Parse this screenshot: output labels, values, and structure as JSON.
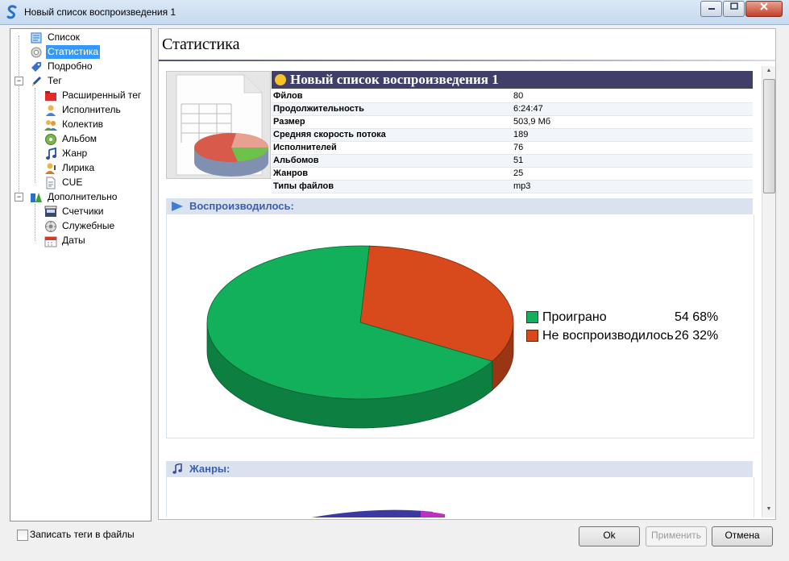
{
  "window": {
    "title": "Новый список воспроизведения 1",
    "controls": [
      "minimize",
      "maximize",
      "close"
    ]
  },
  "sidebar": {
    "items": [
      {
        "label": "Список",
        "icon": "playlist-icon"
      },
      {
        "label": "Статистика",
        "icon": "gear-icon",
        "selected": true
      },
      {
        "label": "Подробно",
        "icon": "tag-detail-icon"
      },
      {
        "label": "Тег",
        "icon": "pen-icon",
        "expanded": true
      },
      {
        "label": "Расширенный тег",
        "icon": "folder-icon"
      },
      {
        "label": "Исполнитель",
        "icon": "person-icon"
      },
      {
        "label": "Колектив",
        "icon": "group-icon"
      },
      {
        "label": "Альбом",
        "icon": "disc-icon"
      },
      {
        "label": "Жанр",
        "icon": "music-note-icon"
      },
      {
        "label": "Лирика",
        "icon": "singer-icon"
      },
      {
        "label": "CUE",
        "icon": "cue-file-icon"
      },
      {
        "label": "Дополнительно",
        "icon": "extra-icon",
        "expanded": true
      },
      {
        "label": "Счетчики",
        "icon": "counter-icon"
      },
      {
        "label": "Служебные",
        "icon": "settings-icon"
      },
      {
        "label": "Даты",
        "icon": "calendar-icon"
      }
    ]
  },
  "page": {
    "title": "Статистика"
  },
  "info": {
    "title": "Новый список воспроизведения 1",
    "rows": [
      {
        "key": "Фйлов",
        "value": "80"
      },
      {
        "key": "Продолжительность",
        "value": "6:24:47"
      },
      {
        "key": "Размер",
        "value": "503,9 Мб"
      },
      {
        "key": "Средняя скорость потока",
        "value": "189"
      },
      {
        "key": "Исполнителей",
        "value": "76"
      },
      {
        "key": "Альбомов",
        "value": "51"
      },
      {
        "key": "Жанров",
        "value": "25"
      },
      {
        "key": "Типы файлов",
        "value": "mp3"
      }
    ]
  },
  "sections": {
    "played": "Воспроизводилось:",
    "genres": "Жанры:"
  },
  "chart_data": {
    "type": "pie",
    "title": "Воспроизводилось:",
    "series": [
      {
        "name": "Проиграно",
        "count": 54,
        "percent": 68,
        "label": "54 68%",
        "color": "#12b05a"
      },
      {
        "name": "Не воспроизводилось",
        "count": 26,
        "percent": 32,
        "label": "26 32%",
        "color": "#d84a1b"
      }
    ],
    "legend_position": "right"
  },
  "footer": {
    "write_tags_label": "Записать теги в файлы",
    "write_tags_checked": false,
    "ok_label": "Ok",
    "apply_label": "Применить",
    "cancel_label": "Отмена"
  }
}
